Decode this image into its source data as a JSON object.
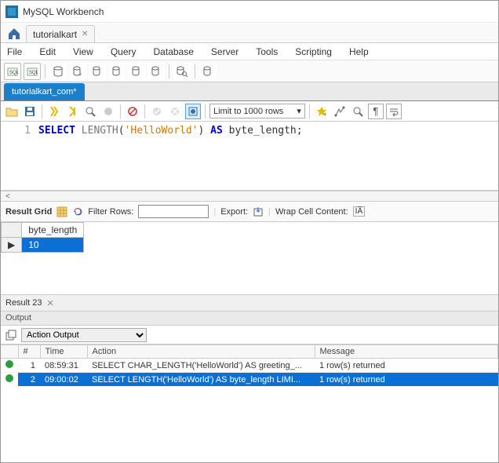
{
  "window": {
    "title": "MySQL Workbench"
  },
  "conn_tab": {
    "label": "tutorialkart"
  },
  "menu": [
    "File",
    "Edit",
    "View",
    "Query",
    "Database",
    "Server",
    "Tools",
    "Scripting",
    "Help"
  ],
  "file_tab": {
    "label": "tutorialkart_com*"
  },
  "limit_rows": {
    "label": "Limit to 1000 rows"
  },
  "editor": {
    "line_no": "1",
    "kw_select": "SELECT",
    "fn_length": "LENGTH",
    "paren_open": "(",
    "str": "'HelloWorld'",
    "paren_close": ")",
    "kw_as": "AS",
    "alias": "byte_length",
    "semi": ";"
  },
  "result_toolbar": {
    "label": "Result Grid",
    "filter_label": "Filter Rows:",
    "export_label": "Export:",
    "wrap_label": "Wrap Cell Content:"
  },
  "grid": {
    "col1": "byte_length",
    "row1_val": "10"
  },
  "result_tab": {
    "label": "Result 23"
  },
  "output": {
    "header": "Output",
    "selector": "Action Output",
    "cols": {
      "idx": "#",
      "time": "Time",
      "action": "Action",
      "message": "Message"
    },
    "rows": [
      {
        "idx": "1",
        "time": "08:59:31",
        "action": "SELECT CHAR_LENGTH('HelloWorld') AS greeting_...",
        "message": "1 row(s) returned"
      },
      {
        "idx": "2",
        "time": "09:00:02",
        "action": "SELECT LENGTH('HelloWorld') AS byte_length LIMI...",
        "message": "1 row(s) returned"
      }
    ]
  }
}
